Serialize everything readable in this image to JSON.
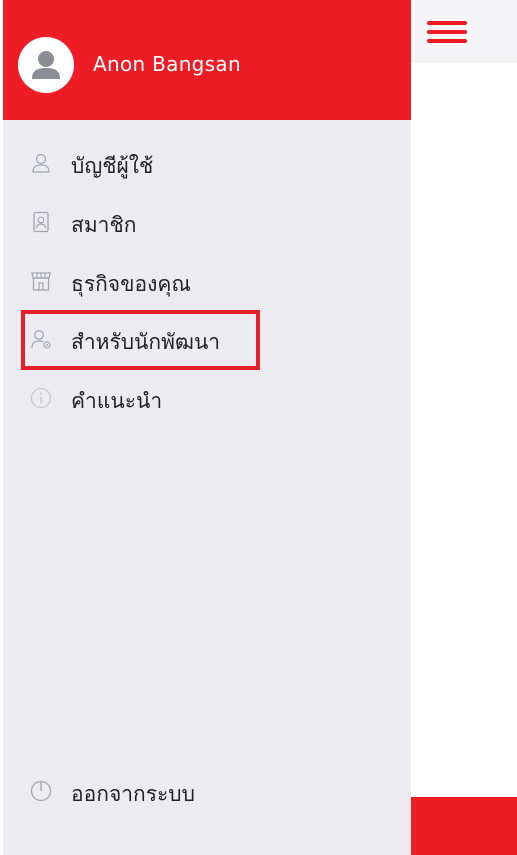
{
  "header": {
    "user_name": "Anon Bangsan",
    "brand_color": "#ee1c25"
  },
  "menu": {
    "items": [
      {
        "label": "บัญชีผู้ใช้",
        "icon": "user-icon"
      },
      {
        "label": "สมาชิก",
        "icon": "member-card-icon"
      },
      {
        "label": "ธุรกิจของคุณ",
        "icon": "store-icon"
      },
      {
        "label": "สำหรับนักพัฒนา",
        "icon": "developer-icon"
      },
      {
        "label": "คำแนะนำ",
        "icon": "info-icon"
      }
    ],
    "logout": {
      "label": "ออกจากระบบ",
      "icon": "power-icon"
    }
  }
}
